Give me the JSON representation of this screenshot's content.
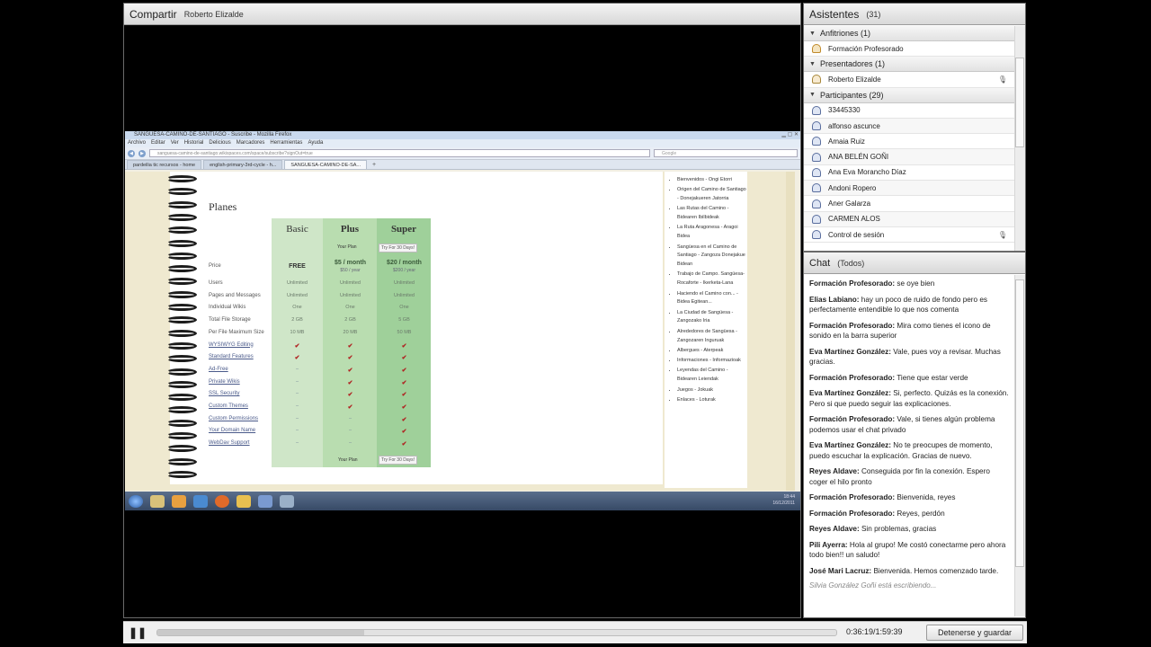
{
  "share": {
    "title": "Compartir",
    "presenter": "Roberto Elizalde"
  },
  "browser": {
    "window_title": "SANGUESA-CAMINO-DE-SANTIAGO - Suscribe - Mozilla Firefox",
    "menu": [
      "Archivo",
      "Editar",
      "Ver",
      "Historial",
      "Delicious",
      "Marcadores",
      "Herramientas",
      "Ayuda"
    ],
    "url": "sanguesa-camino-de-santiago.wikispaces.com/space/subscribe?signOut=true",
    "search_placeholder": "Google",
    "tabs": [
      "pardeilia tic recursos - home",
      "english-primary-3rd-cycle - h...",
      "SANGUESA-CAMINO-DE-SA..."
    ]
  },
  "plans": {
    "title": "Planes",
    "columns": [
      "Basic",
      "Plus",
      "Super"
    ],
    "your_plan": "Your Plan",
    "try_30": "Try For 30 Days!",
    "price_label": "Price",
    "prices": [
      {
        "main": "FREE",
        "sub": ""
      },
      {
        "main": "$5 / month",
        "sub": "$50 / year"
      },
      {
        "main": "$20 / month",
        "sub": "$200 / year"
      }
    ],
    "rows": [
      {
        "label": "Users",
        "link": false,
        "values": [
          "Unlimited",
          "Unlimited",
          "Unlimited"
        ]
      },
      {
        "label": "Pages and Messages",
        "link": false,
        "values": [
          "Unlimited",
          "Unlimited",
          "Unlimited"
        ]
      },
      {
        "label": "Individual Wikis",
        "link": false,
        "values": [
          "One",
          "One",
          "One"
        ]
      },
      {
        "label": "Total File Storage",
        "link": false,
        "values": [
          "2 GB",
          "2 GB",
          "5 GB"
        ]
      },
      {
        "label": "Per File Maximum Size",
        "link": false,
        "values": [
          "10 MB",
          "20 MB",
          "50 MB"
        ]
      },
      {
        "label": "WYSIWYG Editing",
        "link": true,
        "values": [
          "check",
          "check",
          "check"
        ]
      },
      {
        "label": "Standard Features",
        "link": true,
        "values": [
          "check",
          "check",
          "check"
        ]
      },
      {
        "label": "Ad-Free",
        "link": true,
        "values": [
          "dash",
          "check",
          "check"
        ]
      },
      {
        "label": "Private Wikis",
        "link": true,
        "values": [
          "dash",
          "check",
          "check"
        ]
      },
      {
        "label": "SSL Security",
        "link": true,
        "values": [
          "dash",
          "check",
          "check"
        ]
      },
      {
        "label": "Custom Themes",
        "link": true,
        "values": [
          "dash",
          "check",
          "check"
        ]
      },
      {
        "label": "Custom Permissions",
        "link": true,
        "values": [
          "dash",
          "dash",
          "check"
        ]
      },
      {
        "label": "Your Domain Name",
        "link": true,
        "values": [
          "dash",
          "dash",
          "check"
        ]
      },
      {
        "label": "WebDav Support",
        "link": true,
        "values": [
          "dash",
          "dash",
          "check"
        ]
      }
    ]
  },
  "wiki_nav": [
    "Bienvenidos - Ongi Etorri",
    "Origen del Camino de Santiago - Donejakueren Jatorria",
    "Las Rutas del Camino - Bidearen Ibilbideak",
    "La Ruta Aragonesa - Aragoi Bidea",
    "Sangüesa en el Camino de Santiago - Zangoza Donejakue Bidean",
    "Trabajo de Campo. Sangüesa-Rocaforte - Ikerketa-Lana",
    "Haciendo el Camino con... - Bidea Egitean...",
    "La Ciudad de Sangüesa - Zangozako Iria",
    "Alrededores de Sangüesa - Zangozaren Inguruak",
    "Albergues - Aterpeak",
    "Informaciones - Informazioak",
    "Leyendas del Camino - Bidearen Leiendak",
    "Juegos - Jokuak",
    "Enlaces - Loturak"
  ],
  "taskbar": {
    "clock_time": "18:44",
    "clock_date": "16/12/2011"
  },
  "attendees": {
    "title": "Asistentes",
    "count": "(31)",
    "groups": {
      "hosts": {
        "label": "Anfitriones (1)",
        "people": [
          "Formación Profesorado"
        ]
      },
      "presenters": {
        "label": "Presentadores (1)",
        "people": [
          "Roberto Elizalde"
        ]
      },
      "participants": {
        "label": "Participantes (29)",
        "people": [
          "33445330",
          "alfonso ascunce",
          "Amaia Ruiz",
          "ANA BELÉN GOÑI",
          "Ana Eva Morancho Díaz",
          "Andoni Ropero",
          "Aner Galarza",
          "CARMEN ALOS",
          "Control de sesión"
        ]
      }
    }
  },
  "chat": {
    "title": "Chat",
    "scope": "(Todos)",
    "messages": [
      {
        "author": "Formación Profesorado:",
        "text": "se oye bien"
      },
      {
        "author": "Elias Labiano:",
        "text": "hay un poco de ruido de fondo pero es perfectamente entendible lo que nos comenta"
      },
      {
        "author": "Formación Profesorado:",
        "text": "Mira como tienes el icono de sonido en la barra superior"
      },
      {
        "author": "Eva Martínez González:",
        "text": "Vale, pues voy a revisar. Muchas gracias."
      },
      {
        "author": "Formación Profesorado:",
        "text": "Tiene que estar verde"
      },
      {
        "author": "Eva Martínez González:",
        "text": "Si, perfecto. Quizás es la conexión. Pero si que puedo seguir las explicaciones."
      },
      {
        "author": "Formación Profesorado:",
        "text": "Vale, si tienes algún problema podemos usar el chat privado"
      },
      {
        "author": "Eva Martínez González:",
        "text": "No te preocupes de momento, puedo escuchar la explicación. Gracias de nuevo."
      },
      {
        "author": "Reyes Aldave:",
        "text": "Conseguida por fin la conexión. Espero coger el hilo pronto"
      },
      {
        "author": "Formación Profesorado:",
        "text": "Bienvenida, reyes"
      },
      {
        "author": "Formación Profesorado:",
        "text": "Reyes, perdón"
      },
      {
        "author": "Reyes Aldave:",
        "text": "Sin problemas, gracias"
      },
      {
        "author": "Pili Ayerra:",
        "text": "Hola al grupo! Me costó conectarme pero ahora todo bien!! un saludo!"
      },
      {
        "author": "José Mari Lacruz:",
        "text": "Bienvenida. Hemos comenzado tarde."
      }
    ],
    "typing": "Silvia González Goñi está escribiendo..."
  },
  "playback": {
    "progress_fraction": 0.305,
    "time": "0:36:19/1:59:39",
    "stop_save_label": "Detenerse y guardar"
  }
}
